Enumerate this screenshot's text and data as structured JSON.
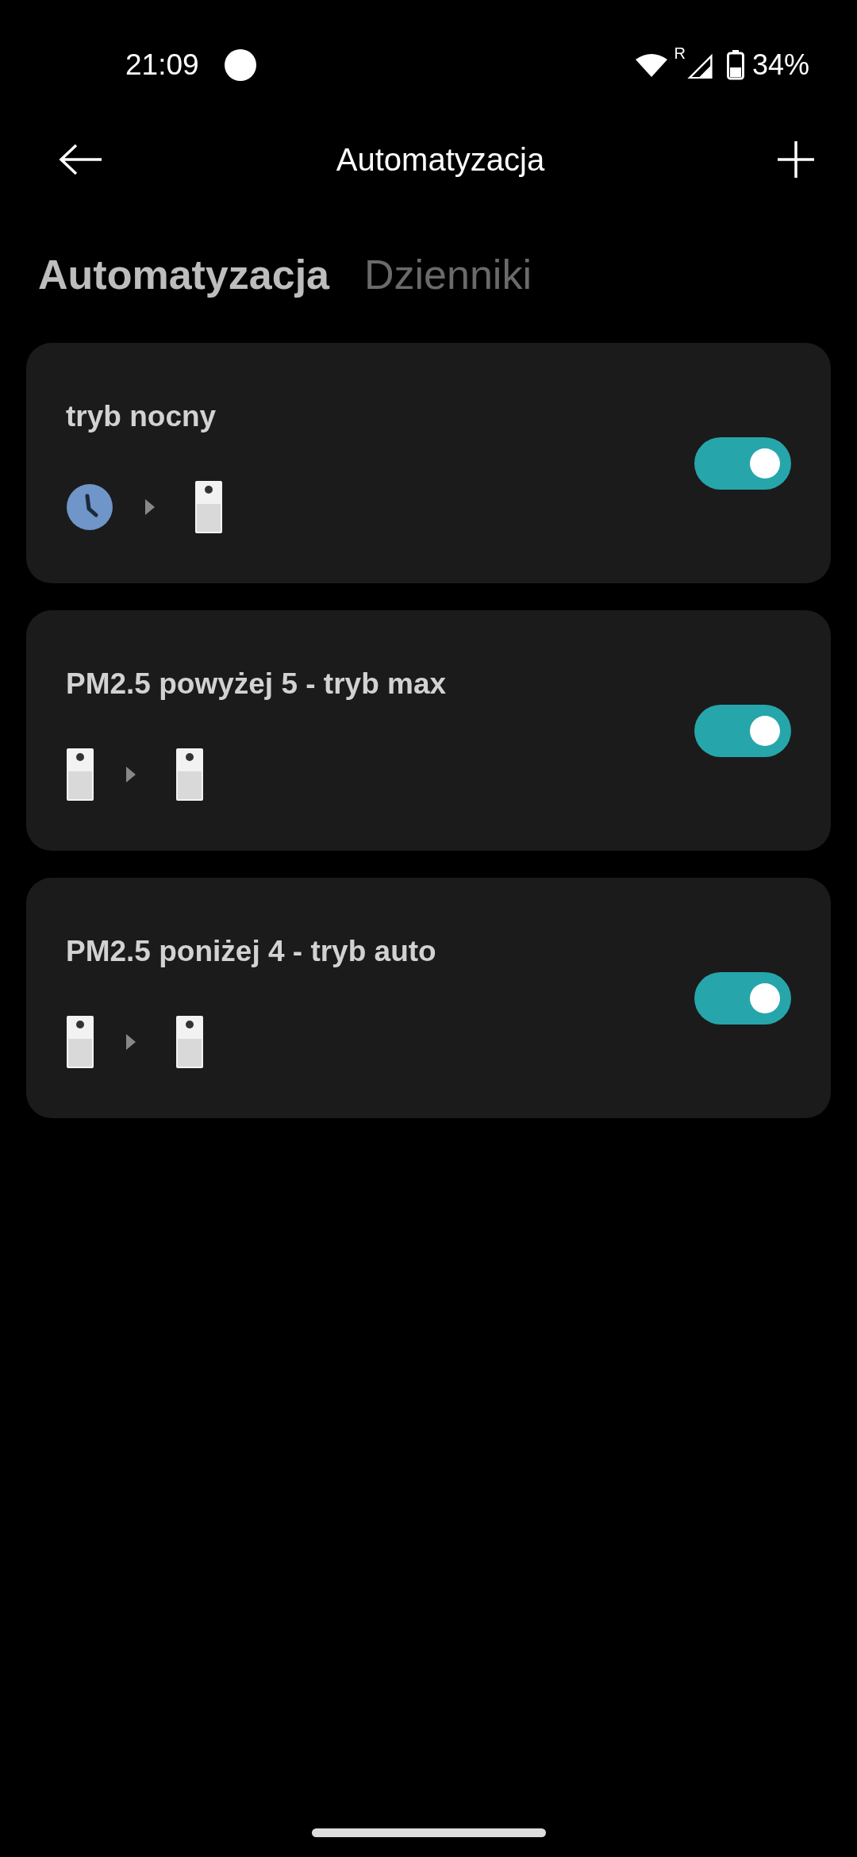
{
  "status_bar": {
    "time": "21:09",
    "roaming": "R",
    "battery": "34%"
  },
  "header": {
    "title": "Automatyzacja"
  },
  "tabs": [
    {
      "label": "Automatyzacja",
      "selected": true
    },
    {
      "label": "Dzienniki",
      "selected": false
    }
  ],
  "automations": [
    {
      "name": "tryb nocny",
      "trigger": {
        "kind": "clock"
      },
      "action": {
        "kind": "purifier"
      },
      "on": true
    },
    {
      "name": "PM2.5 powyżej 5 - tryb max",
      "trigger": {
        "kind": "purifier"
      },
      "action": {
        "kind": "purifier"
      },
      "on": true
    },
    {
      "name": "PM2.5 poniżej 4 - tryb auto",
      "trigger": {
        "kind": "purifier"
      },
      "action": {
        "kind": "purifier"
      },
      "on": true
    }
  ]
}
